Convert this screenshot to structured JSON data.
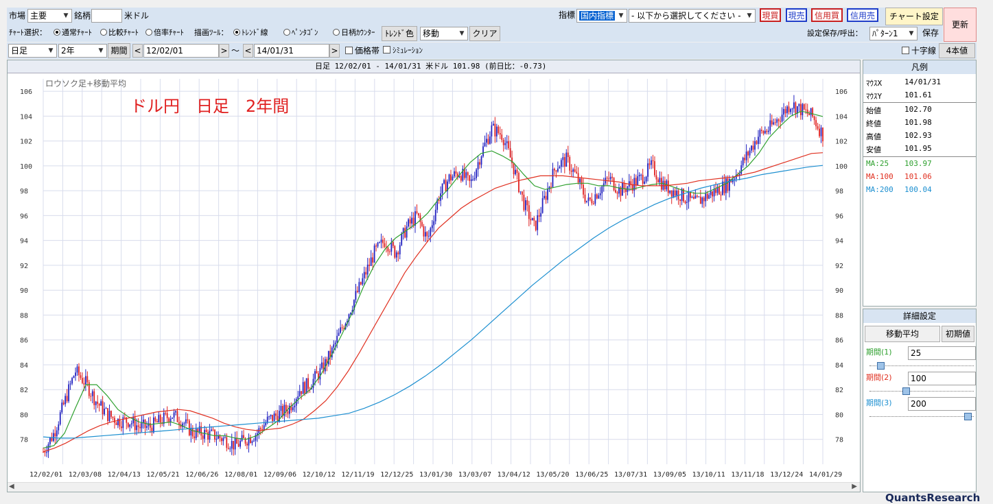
{
  "top": {
    "market_label": "市場",
    "market_value": "主要",
    "symbol_label": "銘柄",
    "symbol_value": "",
    "symbol_name": "米ドル",
    "indicator_label": "指標",
    "indicator_value": "国内指標",
    "indicator_select_placeholder": "- 以下から選択してください -",
    "buttons": {
      "spot_buy": "現買",
      "spot_sell": "現売",
      "credit_buy": "信用買",
      "credit_sell": "信用売",
      "chart_settings": "チャート設定",
      "refresh": "更新"
    }
  },
  "row2": {
    "chart_select_label": "ﾁｬｰﾄ選択：",
    "chart_options": [
      "通常ﾁｬｰﾄ",
      "比較ﾁｬｰﾄ",
      "倍率ﾁｬｰﾄ"
    ],
    "draw_tool_label": "描画ﾂｰﾙ：",
    "draw_options": [
      "ﾄﾚﾝﾄﾞ線",
      "ﾍﾟﾝﾀｺﾞﾝ",
      "日柄ｶｳﾝﾀｰ"
    ],
    "trend_color_button": "ﾄﾚﾝﾄﾞ色",
    "move_select": "移動",
    "clear_button": "クリア",
    "save_label": "設定保存/呼出：",
    "pattern_value": "ﾊﾟﾀｰﾝ1",
    "save_button": "保存"
  },
  "row3": {
    "period_type": "日足",
    "range": "2年",
    "period_button": "期間",
    "from_date": "12/02/01",
    "tilde": "～",
    "to_date": "14/01/31",
    "price_band": "価格帯",
    "simulation": "ｼﾐｭﾚｰｼｮﾝ",
    "crosshair": "十字線",
    "four_values": "4本値"
  },
  "chart": {
    "header": "日足 12/02/01 - 14/01/31  米ドル  101.98 (前日比：-0.73)",
    "subtitle": "ロウソク足+移動平均",
    "overlay_title": "ドル円　日足　2年間"
  },
  "legend": {
    "title": "凡例",
    "mouse_x_label": "ﾏｳｽX",
    "mouse_x": "14/01/31",
    "mouse_y_label": "ﾏｳｽY",
    "mouse_y": "101.61",
    "open_label": "始値",
    "open": "102.70",
    "close_label": "終値",
    "close": "101.98",
    "high_label": "高値",
    "high": "102.93",
    "low_label": "安値",
    "low": "101.95",
    "ma1_label": "MA:25",
    "ma1": "103.97",
    "ma2_label": "MA:100",
    "ma2": "101.06",
    "ma3_label": "MA:200",
    "ma3": "100.04"
  },
  "detail": {
    "title": "詳細設定",
    "tab_ma": "移動平均",
    "tab_initial": "初期値",
    "period1_label": "期間(1)",
    "period1": "25",
    "period2_label": "期間(2)",
    "period2": "100",
    "period3_label": "期間(3)",
    "period3": "200",
    "slider_levels": [
      0.08,
      0.34,
      0.98
    ]
  },
  "brand": "QuantsResearch",
  "colors": {
    "ma25": "#2ea02e",
    "ma100": "#e03020",
    "ma200": "#1c8fd0",
    "candle_up": "#2020c0",
    "candle_down": "#e02020",
    "grid": "#d8dcec",
    "overlay_title": "#e02020"
  },
  "chart_data": {
    "type": "line",
    "title": "ドル円　日足　2年間",
    "ylim": [
      76,
      107
    ],
    "yticks": [
      78,
      80,
      82,
      84,
      86,
      88,
      90,
      92,
      94,
      96,
      98,
      100,
      102,
      104,
      106
    ],
    "x_labels": [
      "12/02/01",
      "12/03/08",
      "12/04/13",
      "12/05/21",
      "12/06/26",
      "12/08/01",
      "12/09/06",
      "12/10/12",
      "12/11/19",
      "12/12/25",
      "13/01/30",
      "13/03/07",
      "13/04/12",
      "13/05/20",
      "13/06/25",
      "13/07/31",
      "13/09/05",
      "13/10/11",
      "13/11/18",
      "13/12/24",
      "14/01/29"
    ],
    "price": [
      77.0,
      78.5,
      81.0,
      83.5,
      82.5,
      81.0,
      80.0,
      79.5,
      79.5,
      79.0,
      79.0,
      79.5,
      80.0,
      79.5,
      78.5,
      78.5,
      78.3,
      78.0,
      77.5,
      78.0,
      78.5,
      79.5,
      80.0,
      80.5,
      82.0,
      82.5,
      83.5,
      85.0,
      87.0,
      89.0,
      91.0,
      93.0,
      94.0,
      93.0,
      95.0,
      96.0,
      94.0,
      97.5,
      99.0,
      99.5,
      98.5,
      101.0,
      103.0,
      102.5,
      100.0,
      97.0,
      95.0,
      97.5,
      100.0,
      100.5,
      99.0,
      97.0,
      98.0,
      99.0,
      98.0,
      98.5,
      99.0,
      100.0,
      98.5,
      98.0,
      97.5,
      97.0,
      97.5,
      98.0,
      98.5,
      99.5,
      101.0,
      102.5,
      103.0,
      104.0,
      105.0,
      104.5,
      104.0,
      102.5
    ],
    "series": [
      {
        "name": "MA:25",
        "values": [
          77.3,
          77.5,
          78.5,
          80.5,
          82.4,
          82.4,
          81.5,
          80.4,
          79.8,
          79.4,
          79.2,
          79.3,
          79.4,
          79.1,
          78.7,
          78.5,
          78.3,
          78.3,
          78.1,
          78.0,
          78.3,
          78.9,
          79.5,
          80.5,
          81.3,
          82.0,
          83.2,
          84.8,
          86.5,
          88.3,
          90.3,
          92.0,
          93.3,
          94.2,
          94.8,
          95.4,
          96.2,
          97.3,
          98.2,
          99.3,
          100.3,
          101.0,
          101.2,
          100.8,
          100.3,
          99.3,
          98.4,
          98.1,
          98.3,
          98.5,
          98.6,
          98.6,
          98.4,
          98.4,
          98.2,
          98.1,
          98.3,
          98.5,
          98.6,
          98.3,
          98.0,
          97.8,
          97.8,
          98.2,
          98.6,
          99.3,
          100.0,
          101.0,
          102.3,
          103.2,
          104.0,
          104.4,
          104.2,
          103.97
        ]
      },
      {
        "name": "MA:100",
        "values": [
          77.0,
          77.3,
          77.7,
          78.2,
          78.7,
          79.1,
          79.4,
          79.6,
          79.8,
          80.0,
          80.2,
          80.3,
          80.4,
          80.3,
          80.0,
          79.7,
          79.3,
          79.0,
          78.8,
          78.7,
          78.8,
          78.9,
          79.2,
          79.6,
          80.3,
          81.1,
          82.2,
          83.5,
          85.0,
          86.6,
          88.2,
          89.8,
          91.4,
          92.7,
          93.9,
          95.0,
          95.8,
          96.6,
          97.2,
          97.7,
          98.2,
          98.5,
          98.8,
          99.0,
          99.2,
          99.2,
          99.2,
          99.1,
          99.0,
          98.9,
          98.8,
          98.7,
          98.5,
          98.4,
          98.4,
          98.4,
          98.5,
          98.6,
          98.8,
          98.9,
          99.0,
          99.1,
          99.3,
          99.5,
          99.8,
          100.1,
          100.4,
          100.7,
          101.0,
          101.06
        ]
      },
      {
        "name": "MA:200",
        "values": [
          78.2,
          78.1,
          78.1,
          78.2,
          78.3,
          78.4,
          78.5,
          78.6,
          78.7,
          78.8,
          78.9,
          79.0,
          79.1,
          79.2,
          79.3,
          79.4,
          79.5,
          79.6,
          79.7,
          79.9,
          80.1,
          80.5,
          81.0,
          81.6,
          82.3,
          83.1,
          84.0,
          85.0,
          86.0,
          87.1,
          88.2,
          89.3,
          90.4,
          91.4,
          92.4,
          93.3,
          94.2,
          95.0,
          95.7,
          96.3,
          96.9,
          97.4,
          97.8,
          98.2,
          98.5,
          98.8,
          99.0,
          99.3,
          99.5,
          99.7,
          99.9,
          100.04
        ]
      }
    ]
  }
}
